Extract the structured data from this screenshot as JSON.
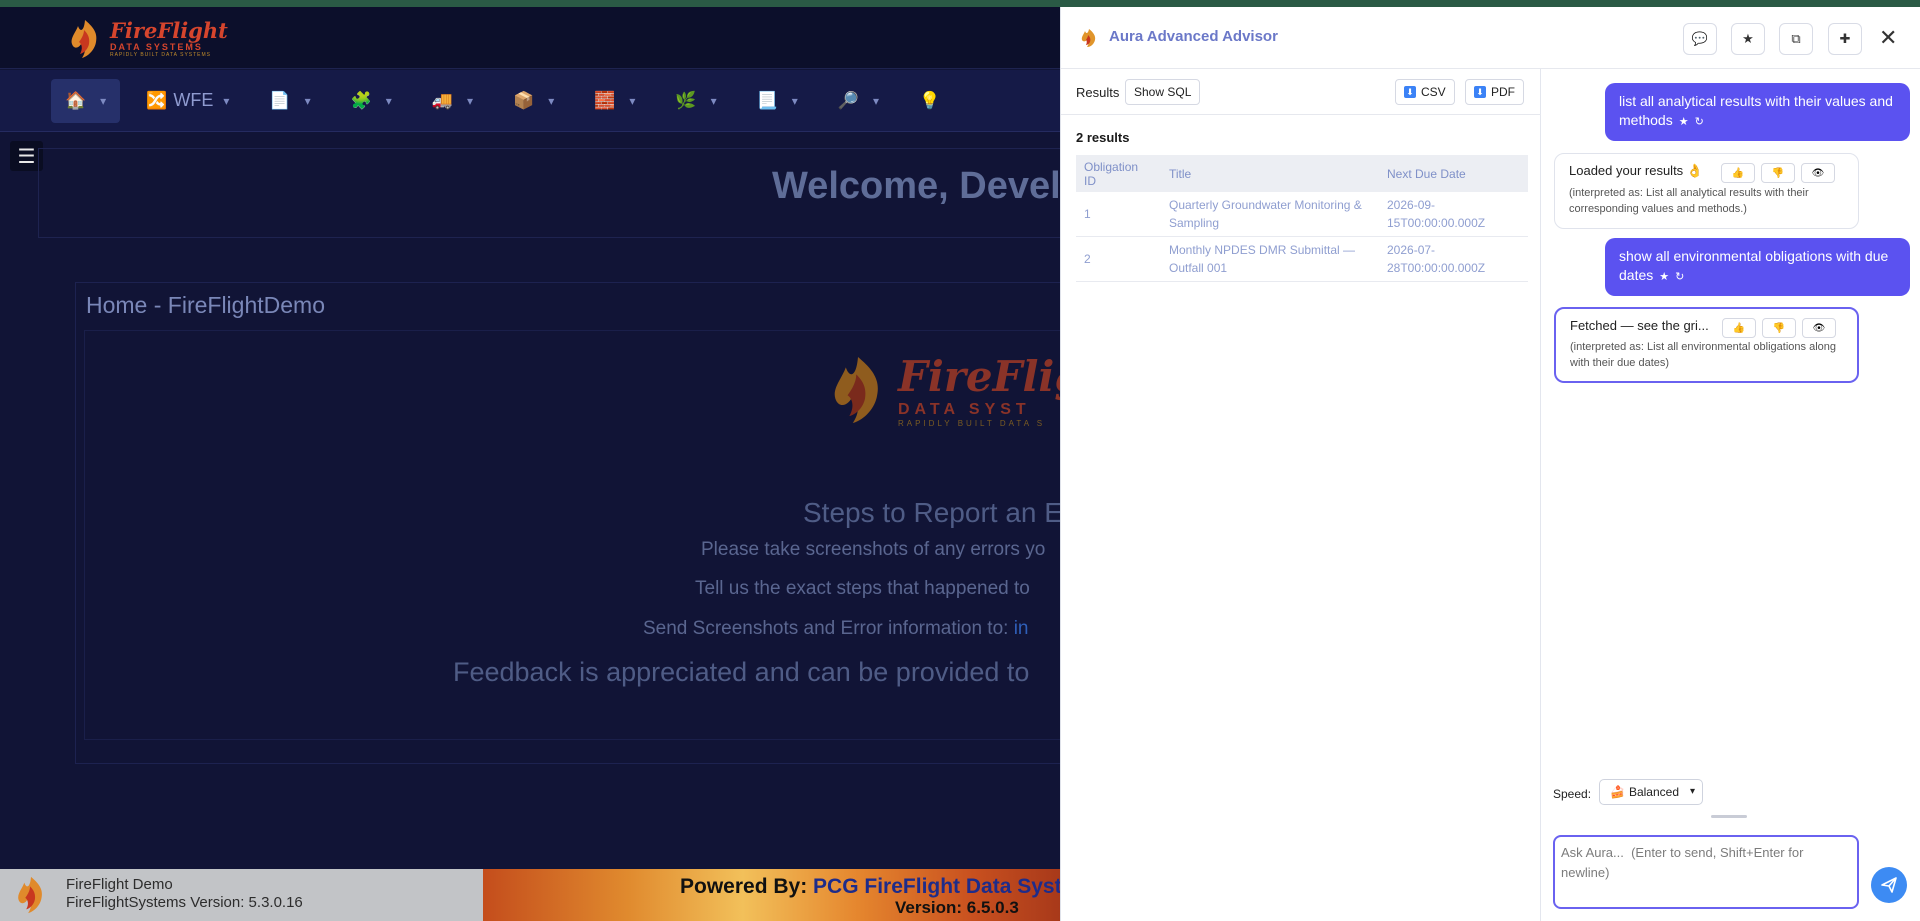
{
  "app": {
    "logo": {
      "line1": "FireFlight",
      "line2": "DATA SYSTEMS",
      "line3": "RAPIDLY BUILT DATA SYSTEMS"
    },
    "nav": [
      {
        "icon": "home-icon",
        "glyph": "🏠",
        "label": ""
      },
      {
        "icon": "shuffle-icon",
        "glyph": "🔀",
        "label": "WFE"
      },
      {
        "icon": "document-icon",
        "glyph": "📄",
        "label": ""
      },
      {
        "icon": "puzzle-icon",
        "glyph": "🧩",
        "label": ""
      },
      {
        "icon": "truck-icon",
        "glyph": "🚚",
        "label": ""
      },
      {
        "icon": "package-icon",
        "glyph": "📦",
        "label": ""
      },
      {
        "icon": "brick-icon",
        "glyph": "🧱",
        "label": ""
      },
      {
        "icon": "leaf-icon",
        "glyph": "🌿",
        "label": ""
      },
      {
        "icon": "file-icon",
        "glyph": "📃",
        "label": ""
      },
      {
        "icon": "magnifier-icon",
        "glyph": "🔎",
        "label": ""
      },
      {
        "icon": "bulb-icon",
        "glyph": "💡",
        "label": ""
      }
    ],
    "welcome": "Welcome, Devel",
    "home_title": "Home - FireFlightDemo",
    "big_logo": {
      "line1": "FireFligh",
      "line2": "DATA SYST",
      "line3": "RAPIDLY BUILT DATA S"
    },
    "steps_title": "Steps to Report an E",
    "line1": "Please take screenshots of any errors yo",
    "line2": "Tell us the exact steps that happened to",
    "line3_prefix": "Send Screenshots and Error information to: ",
    "line3_link": "in",
    "line4": "Feedback is appreciated and can be provided to",
    "footer": {
      "name": "FireFlight Demo",
      "version_text": "FireFlightSystems Version: 5.3.0.16",
      "powered_prefix": "Powered By: ",
      "powered_name": "PCG FireFlight Data Syst",
      "version": "Version: 6.5.0.3"
    }
  },
  "panel": {
    "title": "Aura Advanced Advisor",
    "header_buttons": [
      {
        "name": "chat-history-button",
        "glyph": "💬"
      },
      {
        "name": "favorites-button",
        "glyph": "★"
      },
      {
        "name": "copy-button",
        "glyph": "⧉"
      },
      {
        "name": "new-chat-button",
        "glyph": "✚"
      }
    ],
    "close_glyph": "✕",
    "results": {
      "label": "Results",
      "show_sql": "Show SQL",
      "csv": "CSV",
      "pdf": "PDF",
      "count": "2 results",
      "columns": [
        "Obligation ID",
        "Title",
        "Next Due Date"
      ],
      "rows": [
        [
          "1",
          "Quarterly Groundwater Monitoring & Sampling",
          "2026-09-15T00:00:00.000Z"
        ],
        [
          "2",
          "Monthly NPDES DMR Submittal — Outfall 001",
          "2026-07-28T00:00:00.000Z"
        ]
      ]
    },
    "chat": {
      "messages": [
        {
          "role": "user",
          "text": "list all analytical results with their values and methods"
        },
        {
          "role": "assistant",
          "text": "Loaded your results 👌",
          "interpreted": "(interpreted as: List all analytical results with their corresponding values and methods.)"
        },
        {
          "role": "user",
          "text": "show all environmental obligations with due dates"
        },
        {
          "role": "assistant",
          "text": "Fetched — see the gri...",
          "interpreted": "(interpreted as: List all environmental obligations along with their due dates)"
        }
      ],
      "user_actions": {
        "star": "★",
        "retry": "↻"
      },
      "feedback": {
        "like": "👍",
        "dislike": "👎",
        "view": "👁"
      },
      "speed_label": "Speed:",
      "speed_value": "Balanced",
      "input_placeholder": "Ask Aura...  (Enter to send, Shift+Enter for newline)"
    }
  }
}
